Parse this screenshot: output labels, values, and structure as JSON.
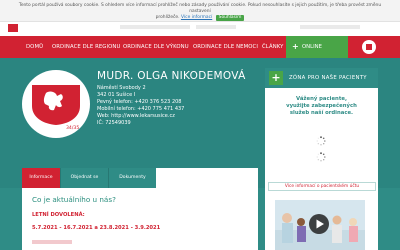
{
  "cookie": {
    "text": "Tento portál používá soubory cookie. S ohledem více informací prohlížeč nebo zásady používání cookie. Pokud nesouhlasíte s jejich použitím, je třeba provést změnu nastavení",
    "text2": "prohlížeče.",
    "more_link": "Více informací",
    "agree_button": "Souhlasím"
  },
  "nav": {
    "items": [
      "DOMŮ",
      "ORDINACE DLE REGIONU",
      "ORDINACE DLE VÝKONU",
      "ORDINACE DLE NEMOCI",
      "ČLÁNKY"
    ],
    "online_label": "ONLINE PORADNA"
  },
  "doctor": {
    "name": "MUDR. OLGA NIKODEMOVÁ",
    "address1": "Náměstí Svobody 2",
    "address2": "342 01 Sušice I",
    "phone": "Pevný telefon: +420 376 523 208",
    "mobile": "Mobilní telefon: +420 775 471 437",
    "web": "Web: http://www.lekarsusice.cz",
    "ic": "IČ: 72549039",
    "logo_number": "34/35"
  },
  "tabs": [
    "Informace",
    "Objednat se",
    "Dokumenty"
  ],
  "content": {
    "title": "Co je aktuálního u nás?",
    "subtitle": "LETNÍ DOVOLENÁ:",
    "dates": "5.7.2021 - 16.7.2021 a 23.8.2021 - 3.9.2021"
  },
  "right_panel": {
    "header": "ZÓNA PRO NAŠE PACIENTY",
    "text_lines": [
      "Vážený paciente,",
      "využijte zabezpečených",
      "služeb naší ordinace."
    ],
    "link": "Více informací o pacientském účtu"
  },
  "colors": {
    "red": "#d12232",
    "teal": "#2f8c86",
    "green": "#49a547"
  },
  "icons": [
    "plus-icon",
    "home-icon",
    "loading-spinner-icon",
    "play-icon",
    "czech-lion-emblem"
  ]
}
